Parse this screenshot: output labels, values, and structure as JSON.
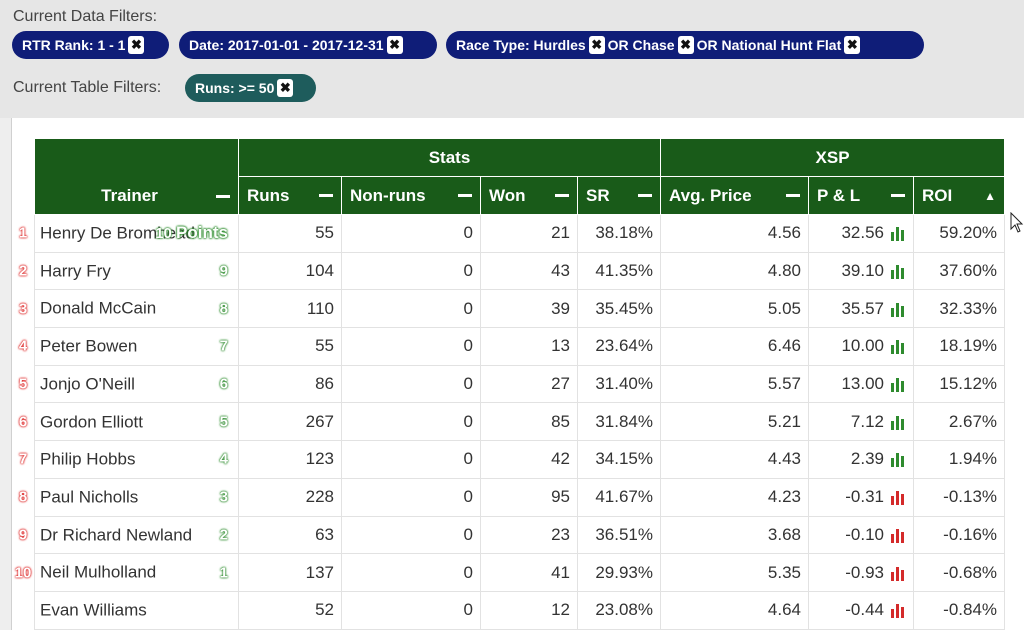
{
  "filters": {
    "data_label": "Current Data Filters:",
    "chips": [
      {
        "parts": [
          "RTR Rank: 1 - 1"
        ]
      },
      {
        "parts": [
          "Date: 2017-01-01 - 2017-12-31"
        ]
      },
      {
        "parts": [
          "Race Type: Hurdles",
          "OR Chase",
          "OR National Hunt Flat"
        ]
      }
    ],
    "table_label": "Current Table Filters:",
    "table_chip": "Runs: >= 50",
    "close_glyph": "✖"
  },
  "table": {
    "group_headers": {
      "stats": "Stats",
      "xsp": "XSP"
    },
    "columns": {
      "trainer": "Trainer",
      "runs": "Runs",
      "nonruns": "Non-runs",
      "won": "Won",
      "sr": "SR",
      "avg_price": "Avg. Price",
      "pl": "P & L",
      "roi": "ROI"
    },
    "sort_indicator": "▲",
    "points_word": "Points",
    "rows": [
      {
        "rank": "1",
        "name": "Henry De Bromhead",
        "points": "10",
        "runs": "55",
        "nonruns": "0",
        "won": "21",
        "sr": "38.18%",
        "avg_price": "4.56",
        "pl": "32.56",
        "roi": "59.20%",
        "sign": "pos"
      },
      {
        "rank": "2",
        "name": "Harry Fry",
        "points": "9",
        "runs": "104",
        "nonruns": "0",
        "won": "43",
        "sr": "41.35%",
        "avg_price": "4.80",
        "pl": "39.10",
        "roi": "37.60%",
        "sign": "pos"
      },
      {
        "rank": "3",
        "name": "Donald McCain",
        "points": "8",
        "runs": "110",
        "nonruns": "0",
        "won": "39",
        "sr": "35.45%",
        "avg_price": "5.05",
        "pl": "35.57",
        "roi": "32.33%",
        "sign": "pos"
      },
      {
        "rank": "4",
        "name": "Peter Bowen",
        "points": "7",
        "runs": "55",
        "nonruns": "0",
        "won": "13",
        "sr": "23.64%",
        "avg_price": "6.46",
        "pl": "10.00",
        "roi": "18.19%",
        "sign": "pos"
      },
      {
        "rank": "5",
        "name": "Jonjo O'Neill",
        "points": "6",
        "runs": "86",
        "nonruns": "0",
        "won": "27",
        "sr": "31.40%",
        "avg_price": "5.57",
        "pl": "13.00",
        "roi": "15.12%",
        "sign": "pos"
      },
      {
        "rank": "6",
        "name": "Gordon Elliott",
        "points": "5",
        "runs": "267",
        "nonruns": "0",
        "won": "85",
        "sr": "31.84%",
        "avg_price": "5.21",
        "pl": "7.12",
        "roi": "2.67%",
        "sign": "pos"
      },
      {
        "rank": "7",
        "name": "Philip Hobbs",
        "points": "4",
        "runs": "123",
        "nonruns": "0",
        "won": "42",
        "sr": "34.15%",
        "avg_price": "4.43",
        "pl": "2.39",
        "roi": "1.94%",
        "sign": "pos"
      },
      {
        "rank": "8",
        "name": "Paul Nicholls",
        "points": "3",
        "runs": "228",
        "nonruns": "0",
        "won": "95",
        "sr": "41.67%",
        "avg_price": "4.23",
        "pl": "-0.31",
        "roi": "-0.13%",
        "sign": "neg"
      },
      {
        "rank": "9",
        "name": "Dr Richard Newland",
        "points": "2",
        "runs": "63",
        "nonruns": "0",
        "won": "23",
        "sr": "36.51%",
        "avg_price": "3.68",
        "pl": "-0.10",
        "roi": "-0.16%",
        "sign": "neg"
      },
      {
        "rank": "10",
        "name": "Neil Mulholland",
        "points": "1",
        "runs": "137",
        "nonruns": "0",
        "won": "41",
        "sr": "29.93%",
        "avg_price": "5.35",
        "pl": "-0.93",
        "roi": "-0.68%",
        "sign": "neg"
      },
      {
        "rank": "",
        "name": "Evan Williams",
        "points": "",
        "runs": "52",
        "nonruns": "0",
        "won": "12",
        "sr": "23.08%",
        "avg_price": "4.64",
        "pl": "-0.44",
        "roi": "-0.84%",
        "sign": "neg"
      }
    ]
  },
  "colors": {
    "header_green": "#195b19",
    "positive": "#2e8b2e",
    "negative": "#d42a2a",
    "chip_navy": "#0f1d78",
    "chip_teal": "#1e5c5c"
  },
  "icons": {
    "chart": "bar-chart-icon",
    "remove": "close-icon",
    "collapse": "minus-icon",
    "sort": "sort-ascending-icon",
    "cursor": "mouse-pointer-icon"
  }
}
